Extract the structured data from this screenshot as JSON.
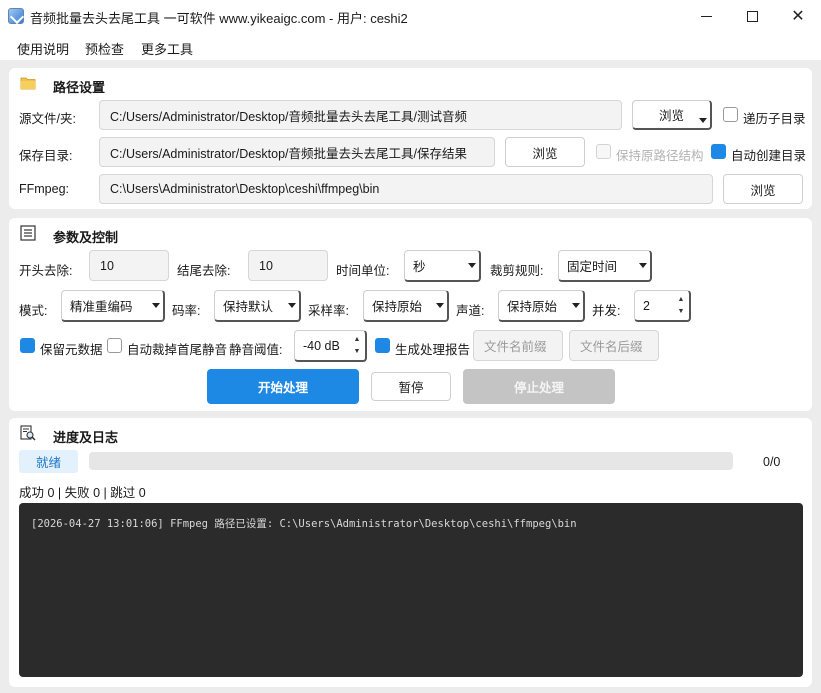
{
  "window": {
    "title": "音频批量去头去尾工具 一可软件 www.yikeaigc.com - 用户: ceshi2",
    "minimize_icon": "minimize-icon",
    "maximize_icon": "maximize-icon",
    "close_icon": "close-icon"
  },
  "menu": [
    "使用说明",
    "预检查",
    "更多工具"
  ],
  "path_section": {
    "title": "路径设置",
    "icon": "folder-icon",
    "source_label": "源文件/夹:",
    "source_value": "C:/Users/Administrator/Desktop/音频批量去头去尾工具/测试音频",
    "browse_label": "浏览",
    "recursive_label": "递历子目录",
    "recursive_checked": false,
    "save_label": "保存目录:",
    "save_value": "C:/Users/Administrator/Desktop/音频批量去头去尾工具/保存结果",
    "keep_structure_label": "保持原路径结构",
    "keep_structure_checked": false,
    "auto_create_label": "自动创建目录",
    "auto_create_checked": true,
    "ffmpeg_label": "FFmpeg:",
    "ffmpeg_value": "C:\\Users\\Administrator\\Desktop\\ceshi\\ffmpeg\\bin"
  },
  "params_section": {
    "title": "参数及控制",
    "icon": "list-icon",
    "head_trim_label": "开头去除:",
    "head_trim_value": "10",
    "tail_trim_label": "结尾去除:",
    "tail_trim_value": "10",
    "time_unit_label": "时间单位:",
    "time_unit_value": "秒",
    "cut_rule_label": "裁剪规则:",
    "cut_rule_value": "固定时间",
    "mode_label": "模式:",
    "mode_value": "精准重编码",
    "bitrate_label": "码率:",
    "bitrate_value": "保持默认",
    "samplerate_label": "采样率:",
    "samplerate_value": "保持原始",
    "channel_label": "声道:",
    "channel_value": "保持原始",
    "concurrency_label": "并发:",
    "concurrency_value": "2",
    "keep_meta_label": "保留元数据",
    "keep_meta_checked": true,
    "auto_silence_label": "自动裁掉首尾静音",
    "auto_silence_checked": false,
    "silence_threshold_label": "静音阈值:",
    "silence_threshold_value": "-40 dB",
    "report_label": "生成处理报告",
    "report_checked": true,
    "prefix_placeholder": "文件名前缀",
    "suffix_placeholder": "文件名后缀",
    "start_label": "开始处理",
    "pause_label": "暂停",
    "stop_label": "停止处理",
    "accent_color": "#1e88e5",
    "disabled_color": "#c4c4c4"
  },
  "progress_section": {
    "title": "进度及日志",
    "icon": "search-document-icon",
    "status": "就绪",
    "progress_fraction": 0,
    "progress_count": "0/0",
    "summary": "成功 0 | 失败 0 | 跳过 0",
    "log_lines": [
      "[2026-04-27 13:01:06] FFmpeg 路径已设置: C:\\Users\\Administrator\\Desktop\\ceshi\\ffmpeg\\bin"
    ]
  }
}
